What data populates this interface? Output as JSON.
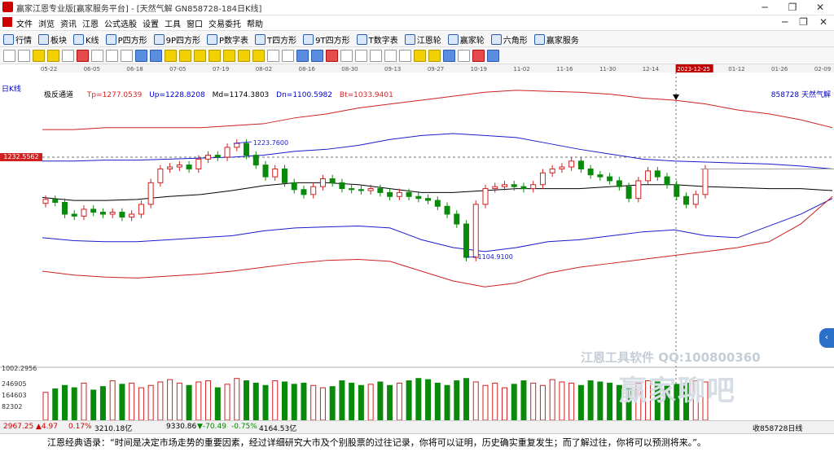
{
  "window": {
    "title": "赢家江恩专业版[赢家服务平台] - [天然气解  GN858728-184日K线]"
  },
  "menu": [
    "文件",
    "浏览",
    "资讯",
    "江恩",
    "公式选股",
    "设置",
    "工具",
    "窗口",
    "交易委托",
    "帮助"
  ],
  "window_buttons": {
    "minimize": "─",
    "restore": "❐",
    "close": "✕"
  },
  "inner_window_buttons": {
    "minimize": "─",
    "restore": "❐",
    "close": "✕"
  },
  "toolbar": [
    "行情",
    "板块",
    "K线",
    "P四方形",
    "9P四方形",
    "P数字表",
    "T四方形",
    "9T四方形",
    "T数字表",
    "江恩轮",
    "赢家轮",
    "六角形",
    "赢家服务"
  ],
  "period_label": "日K线",
  "indicator": {
    "name": "极反通道",
    "tp": "Tp=1277.0539",
    "up": "Up=1228.8208",
    "md": "Md=1174.3803",
    "dn": "Dn=1100.5982",
    "bt": "Bt=1033.9401"
  },
  "instrument_code": "858728  天然气解",
  "dates": [
    "05-22",
    "06-05",
    "06-18",
    "07-05",
    "07-19",
    "08-02",
    "08-16",
    "08-30",
    "09-13",
    "09-27",
    "10-19",
    "11-02",
    "11-16",
    "11-30",
    "12-14",
    "2023-12-25",
    "01-12",
    "01-26",
    "02-09"
  ],
  "price_marker": "1232.5562",
  "annotations": {
    "high": "1223.7600",
    "low": "1104.9100"
  },
  "volume_axis": [
    "1002.2956",
    "246905",
    "164603",
    "82302"
  ],
  "status": {
    "sh": "2967.25",
    "sh_change": "▲4.97",
    "sh_pct": "0.17%",
    "sh_amount": "3210.18亿",
    "sz": "9330.86",
    "sz_change": "▼-70.49",
    "sz_pct": "-0.75%",
    "sz_amount": "4164.53亿",
    "right": "收858728日线"
  },
  "watermark": {
    "line1": "江恩工具软件  QQ:100800360",
    "line2": "赢家聊吧"
  },
  "quote": "江恩经典语录：“时间是决定市场走势的重要因素，经过详细研究大市及个别股票的过往记录，你将可以证明，历史确实重复发生；而了解过往，你将可以预测将来。”。",
  "colors": {
    "up": "#d22020",
    "down": "#0a8a0a",
    "upper_band": "#cc2222",
    "mid_band": "#1a1acc",
    "md": "#000000"
  },
  "chart_data": {
    "type": "candlestick",
    "start_date": "2023-05-22",
    "dates": [
      "05-22",
      "06-05",
      "06-18",
      "07-05",
      "07-19",
      "08-02",
      "08-16",
      "08-30",
      "09-13",
      "09-27",
      "10-19",
      "11-02",
      "11-16",
      "11-30",
      "12-14",
      "2023-12-25",
      "01-12",
      "01-26",
      "02-09"
    ],
    "ylim": [
      1000,
      1290
    ],
    "close": [
      1165,
      1162,
      1150,
      1148,
      1155,
      1152,
      1150,
      1152,
      1147,
      1150,
      1160,
      1182,
      1196,
      1198,
      1200,
      1196,
      1206,
      1210,
      1208,
      1218,
      1222,
      1210,
      1200,
      1188,
      1196,
      1182,
      1175,
      1170,
      1178,
      1186,
      1182,
      1176,
      1175,
      1174,
      1176,
      1172,
      1168,
      1172,
      1168,
      1166,
      1164,
      1158,
      1150,
      1140,
      1106,
      1160,
      1176,
      1178,
      1180,
      1178,
      1176,
      1180,
      1192,
      1196,
      1198,
      1204,
      1196,
      1190,
      1188,
      1184,
      1178,
      1166,
      1184,
      1194,
      1188,
      1180,
      1168,
      1160,
      1170,
      1196
    ],
    "upper_outer": [
      1236,
      1236,
      1238,
      1238,
      1238,
      1238,
      1240,
      1242,
      1248,
      1252,
      1258,
      1262,
      1266,
      1270,
      1274,
      1276,
      1275,
      1274,
      1272,
      1268,
      1266,
      1262,
      1256,
      1252,
      1246,
      1238
    ],
    "upper_inner": [
      1204,
      1204,
      1205,
      1205,
      1206,
      1207,
      1208,
      1210,
      1214,
      1216,
      1220,
      1226,
      1230,
      1232,
      1230,
      1228,
      1222,
      1216,
      1211,
      1206,
      1204,
      1203,
      1202,
      1201,
      1199,
      1196
    ],
    "mid": [
      1167,
      1164,
      1164,
      1165,
      1168,
      1170,
      1174,
      1179,
      1182,
      1182,
      1180,
      1176,
      1172,
      1172,
      1174,
      1176,
      1176,
      1176,
      1178,
      1180,
      1180,
      1178,
      1177,
      1176,
      1176,
      1174
    ],
    "lower_inner": [
      1126,
      1123,
      1122,
      1122,
      1124,
      1126,
      1128,
      1133,
      1136,
      1137,
      1138,
      1136,
      1124,
      1116,
      1112,
      1116,
      1122,
      1124,
      1128,
      1132,
      1134,
      1128,
      1126,
      1138,
      1150,
      1166
    ],
    "lower_outer": [
      1092,
      1088,
      1086,
      1085,
      1087,
      1089,
      1092,
      1096,
      1100,
      1103,
      1104,
      1102,
      1092,
      1082,
      1076,
      1080,
      1090,
      1096,
      1100,
      1104,
      1108,
      1112,
      1116,
      1122,
      1140,
      1168
    ],
    "volume": [
      120,
      135,
      150,
      140,
      160,
      130,
      145,
      170,
      155,
      160,
      140,
      150,
      165,
      175,
      160,
      150,
      165,
      170,
      140,
      155,
      180,
      170,
      160,
      150,
      170,
      165,
      155,
      160,
      150,
      140,
      145,
      170,
      160,
      150,
      155,
      165,
      150,
      160,
      170,
      180,
      175,
      160,
      150,
      170,
      180,
      165,
      150,
      160,
      140,
      155,
      170,
      160,
      150,
      175,
      165,
      160,
      150,
      170,
      165,
      160,
      150,
      140,
      160,
      170,
      165,
      150,
      155,
      160,
      170,
      165
    ]
  }
}
